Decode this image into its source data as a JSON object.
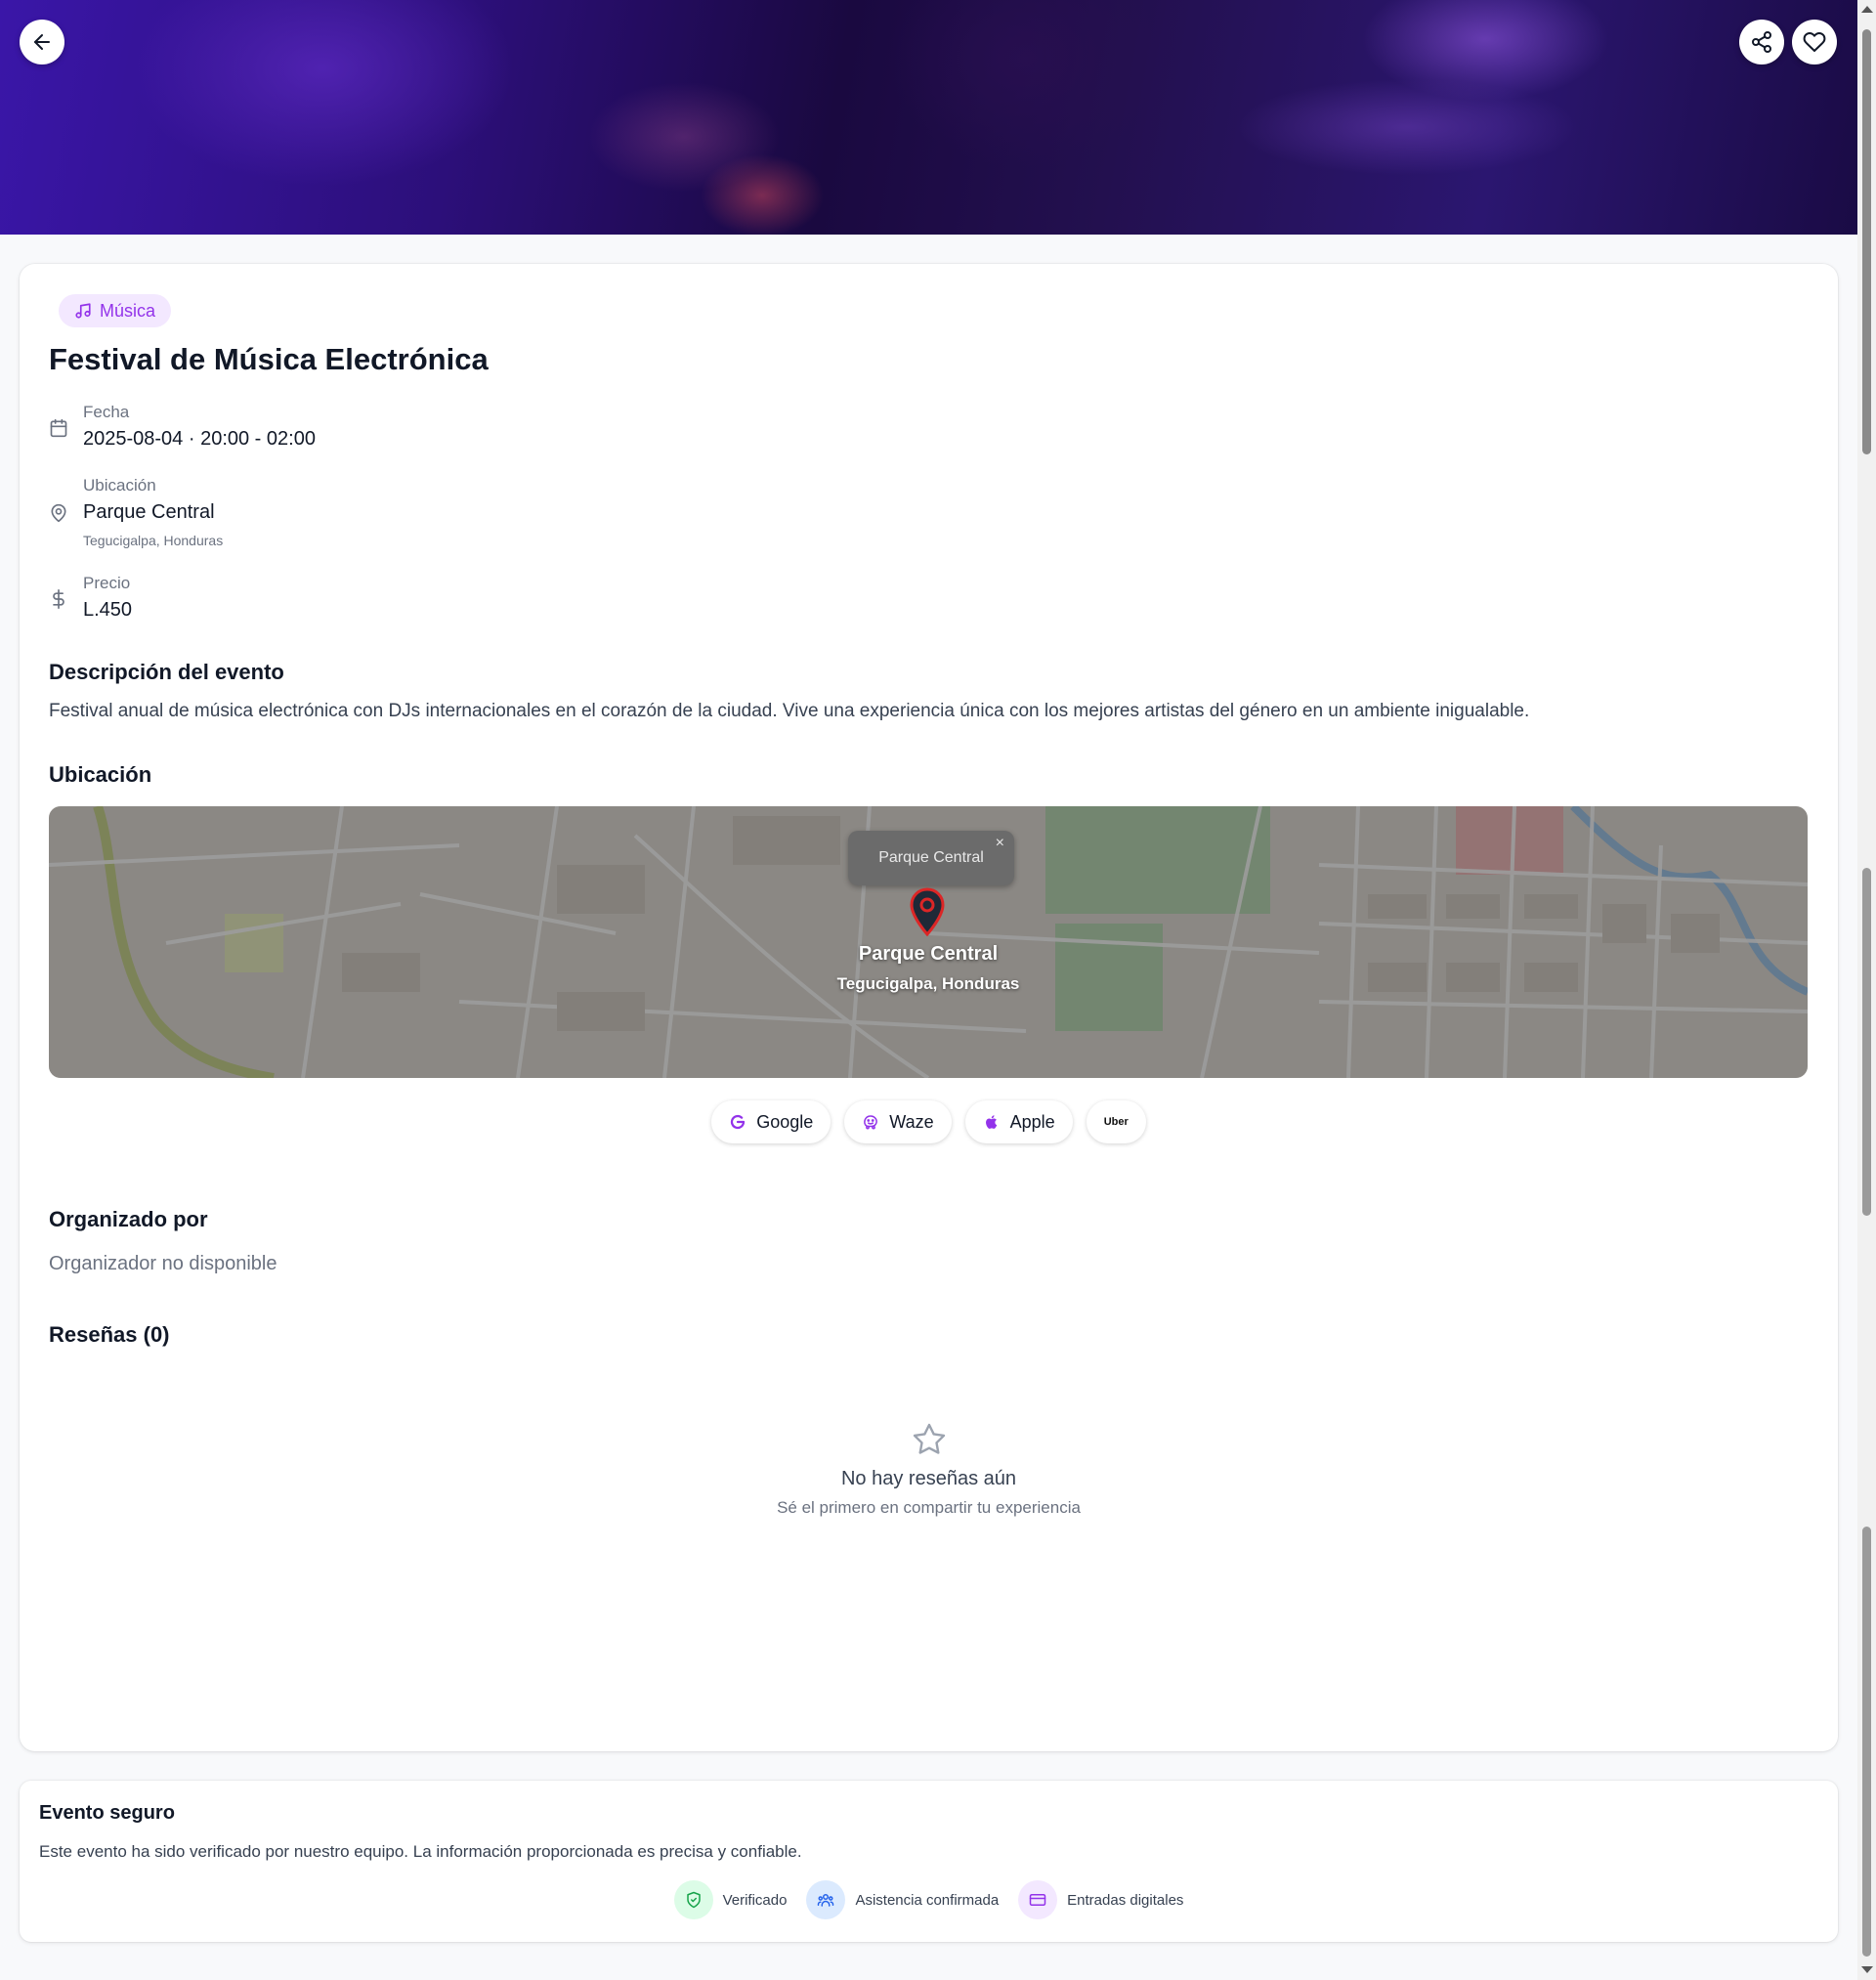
{
  "header": {
    "back_icon": "arrow-left-icon",
    "share_icon": "share-icon",
    "favorite_icon": "heart-icon"
  },
  "event": {
    "category": "Música",
    "category_icon": "music-note-icon",
    "title": "Festival de Música Electrónica",
    "date_label": "Fecha",
    "date_value": "2025-08-04 · 20:00 - 02:00",
    "location_label": "Ubicación",
    "location_value": "Parque Central",
    "location_city": "Tegucigalpa, Honduras",
    "price_label": "Precio",
    "price_value": "L.450"
  },
  "description": {
    "heading": "Descripción del evento",
    "text": "Festival anual de música electrónica con DJs internacionales en el corazón de la ciudad. Vive una experiencia única con los mejores artistas del género en un ambiente inigualable."
  },
  "location_section": {
    "heading": "Ubicación",
    "map_popup": "Parque Central",
    "map_popup_close": "×",
    "map_place": "Parque Central",
    "map_city": "Tegucigalpa, Honduras",
    "nav_buttons": {
      "google": "Google",
      "waze": "Waze",
      "apple": "Apple",
      "uber": "Uber"
    }
  },
  "organizer": {
    "heading": "Organizado por",
    "empty": "Organizador no disponible"
  },
  "reviews": {
    "heading": "Reseñas (0)",
    "empty_title": "No hay reseñas aún",
    "empty_sub": "Sé el primero en compartir tu experiencia"
  },
  "secure": {
    "title": "Evento seguro",
    "text": "Este evento ha sido verificado por nuestro equipo. La información proporcionada es precisa y confiable.",
    "features": [
      "Verificado",
      "Asistencia confirmada",
      "Entradas digitales"
    ]
  },
  "colors": {
    "accent": "#9333ea",
    "badge_bg": "#f3e8ff",
    "verified": "#16a34a",
    "attendance": "#2563eb",
    "tickets": "#9333ea",
    "pin": "#dc2626"
  }
}
